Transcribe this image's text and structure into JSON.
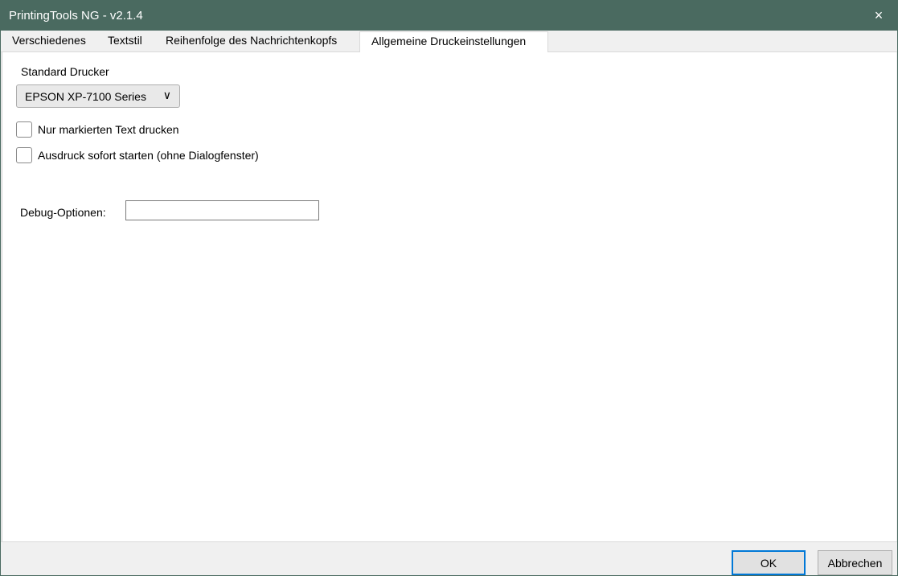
{
  "window": {
    "title": "PrintingTools NG - v2.1.4",
    "close_icon": "×"
  },
  "tabs": [
    {
      "label": "Verschiedenes",
      "active": false
    },
    {
      "label": "Textstil",
      "active": false
    },
    {
      "label": "Reihenfolge des Nachrichtenkopfs",
      "active": false
    },
    {
      "label": "Allgemeine Druckeinstellungen",
      "active": true
    }
  ],
  "printer": {
    "label": "Standard Drucker",
    "selected": "EPSON XP-7100 Series",
    "chevron": "∨"
  },
  "checkboxes": [
    {
      "label": "Nur markierten Text drucken",
      "checked": false
    },
    {
      "label": "Ausdruck sofort starten (ohne Dialogfenster)",
      "checked": false
    }
  ],
  "debug": {
    "label": "Debug-Optionen:",
    "value": ""
  },
  "footer": {
    "ok": "OK",
    "cancel": "Abbrechen"
  }
}
